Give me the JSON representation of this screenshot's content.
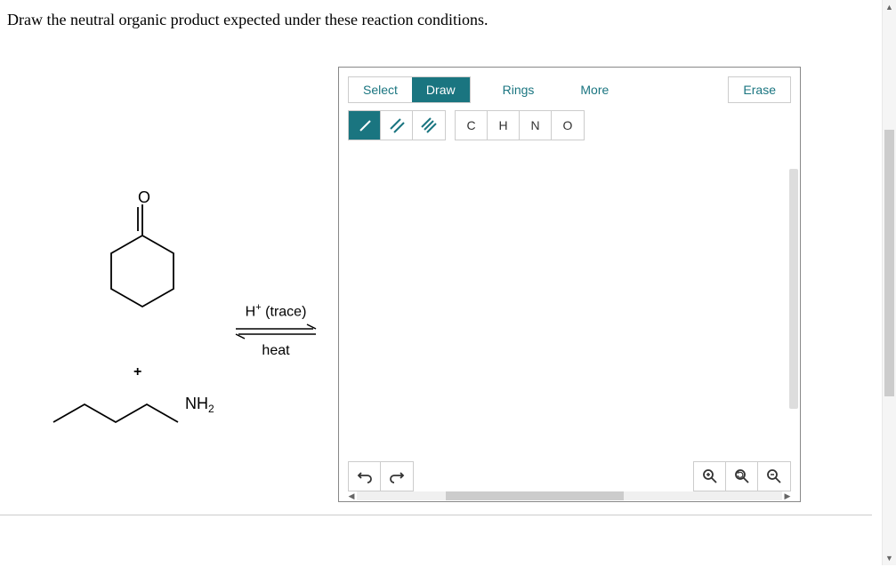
{
  "question": "Draw the neutral organic product expected under these reaction conditions.",
  "reaction": {
    "reactant1_label": "O",
    "plus": "+",
    "reactant2_label": "NH",
    "reactant2_sub": "2",
    "conditions_top_pre": "H",
    "conditions_top_sup": "+",
    "conditions_top_post": " (trace)",
    "conditions_bottom": "heat"
  },
  "editor": {
    "tabs": {
      "select": "Select",
      "draw": "Draw",
      "rings": "Rings",
      "more": "More"
    },
    "erase": "Erase",
    "atoms": {
      "c": "C",
      "h": "H",
      "n": "N",
      "o": "O"
    }
  }
}
